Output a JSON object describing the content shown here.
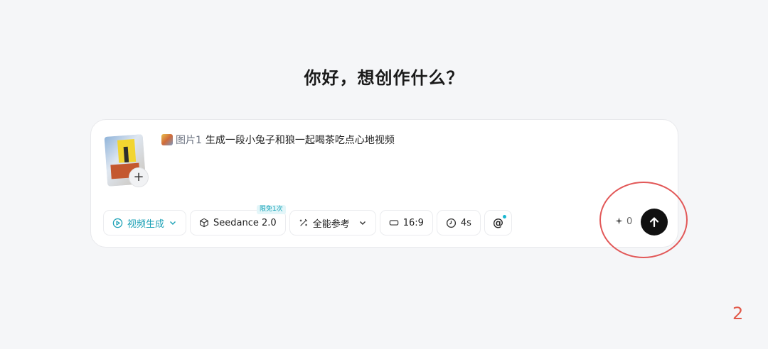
{
  "title": "你好，想创作什么？",
  "prompt": {
    "ref_label": "图片1",
    "text": "生成一段小兔子和狼一起喝茶吃点心地视频"
  },
  "upload": {
    "add_symbol": "+"
  },
  "toolbar": {
    "mode": "视频生成",
    "model": "Seedance 2.0",
    "model_badge": "限免1次",
    "reference": "全能参考",
    "ratio": "16:9",
    "duration": "4s",
    "mention": "@"
  },
  "credits": {
    "value": "0"
  },
  "annotation": {
    "step": "2"
  },
  "colors": {
    "accent": "#1aa0b5",
    "send_bg": "#111111",
    "highlight": "#e25858"
  }
}
